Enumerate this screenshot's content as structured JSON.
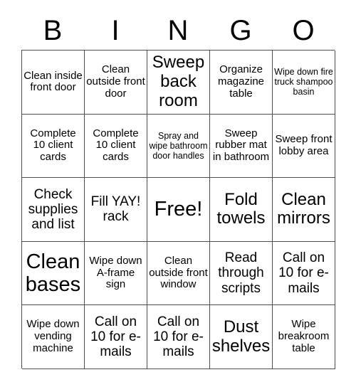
{
  "header": {
    "letters": [
      "B",
      "I",
      "N",
      "G",
      "O"
    ]
  },
  "grid": {
    "rows": [
      [
        {
          "text": "Clean inside front door",
          "size": "sm"
        },
        {
          "text": "Clean outside front door",
          "size": "sm"
        },
        {
          "text": "Sweep back room",
          "size": "lg"
        },
        {
          "text": "Organize magazine table",
          "size": "sm"
        },
        {
          "text": "Wipe down fire truck shampoo basin",
          "size": "xs"
        }
      ],
      [
        {
          "text": "Complete 10 client cards",
          "size": "sm"
        },
        {
          "text": "Complete 10 client cards",
          "size": "sm"
        },
        {
          "text": "Spray and wipe bathroom door handles",
          "size": "xs"
        },
        {
          "text": "Sweep rubber mat in bathroom",
          "size": "sm"
        },
        {
          "text": "Sweep front lobby area",
          "size": "sm"
        }
      ],
      [
        {
          "text": "Check supplies and list",
          "size": "md"
        },
        {
          "text": "Fill YAY! rack",
          "size": "md"
        },
        {
          "text": "Free!",
          "size": "xl"
        },
        {
          "text": "Fold towels",
          "size": "lg"
        },
        {
          "text": "Clean mirrors",
          "size": "lg"
        }
      ],
      [
        {
          "text": "Clean bases",
          "size": "xl"
        },
        {
          "text": "Wipe down A-frame sign",
          "size": "sm"
        },
        {
          "text": "Clean outside front window",
          "size": "sm"
        },
        {
          "text": "Read through scripts",
          "size": "md"
        },
        {
          "text": "Call on 10 for e-mails",
          "size": "md"
        }
      ],
      [
        {
          "text": "Wipe down vending machine",
          "size": "sm"
        },
        {
          "text": "Call on 10 for e-mails",
          "size": "md"
        },
        {
          "text": "Call on 10 for e-mails",
          "size": "md"
        },
        {
          "text": "Dust shelves",
          "size": "lg"
        },
        {
          "text": "Wipe breakroom table",
          "size": "sm"
        }
      ]
    ]
  },
  "colors": {
    "background": "#ffffff",
    "text": "#000000",
    "border": "#4d4d4d"
  }
}
